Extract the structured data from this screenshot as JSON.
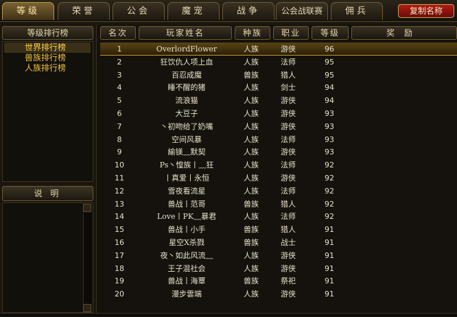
{
  "tabs": [
    {
      "label": "等级",
      "active": true
    },
    {
      "label": "荣誉",
      "active": false
    },
    {
      "label": "公会",
      "active": false
    },
    {
      "label": "魔宠",
      "active": false
    },
    {
      "label": "战争",
      "active": false
    },
    {
      "label": "公会战联赛",
      "active": false
    },
    {
      "label": "佣兵",
      "active": false
    }
  ],
  "copy_name_button": "复制名称",
  "sidebar": {
    "title": "等级排行榜",
    "items": [
      "世界排行榜",
      "兽族排行榜",
      "人族排行榜"
    ],
    "selected_index": 0,
    "description_title": "说 明"
  },
  "table": {
    "headers": [
      "名次",
      "玩家姓名",
      "种族",
      "职业",
      "等级",
      "奖励"
    ],
    "selected_index": 0,
    "rows": [
      {
        "rank": "1",
        "name": "OverlordFlower",
        "race": "人族",
        "job": "游侠",
        "level": "96"
      },
      {
        "rank": "2",
        "name": "狂饮仇人项上血",
        "race": "人族",
        "job": "法师",
        "level": "95"
      },
      {
        "rank": "3",
        "name": "百忍成魔",
        "race": "兽族",
        "job": "猎人",
        "level": "95"
      },
      {
        "rank": "4",
        "name": "睡不醒的猪",
        "race": "人族",
        "job": "剑士",
        "level": "94"
      },
      {
        "rank": "5",
        "name": "流浪猫",
        "race": "人族",
        "job": "游侠",
        "level": "94"
      },
      {
        "rank": "6",
        "name": "大豆子",
        "race": "人族",
        "job": "游侠",
        "level": "93"
      },
      {
        "rank": "7",
        "name": "丶初吻给了奶嘴",
        "race": "人族",
        "job": "游侠",
        "level": "93"
      },
      {
        "rank": "8",
        "name": "空间风暴",
        "race": "人族",
        "job": "法师",
        "level": "93"
      },
      {
        "rank": "9",
        "name": "緰镁﹏默契",
        "race": "人族",
        "job": "游侠",
        "level": "93"
      },
      {
        "rank": "10",
        "name": "Ps丶惶族丨﹏狂",
        "race": "人族",
        "job": "法师",
        "level": "92"
      },
      {
        "rank": "11",
        "name": "丨真爱丨永恒",
        "race": "人族",
        "job": "游侠",
        "level": "92"
      },
      {
        "rank": "12",
        "name": "雪夜看流星",
        "race": "人族",
        "job": "法师",
        "level": "92"
      },
      {
        "rank": "13",
        "name": "兽战丨范哥",
        "race": "兽族",
        "job": "猎人",
        "level": "92"
      },
      {
        "rank": "14",
        "name": "Love丨PK﹏暴君",
        "race": "人族",
        "job": "法师",
        "level": "92"
      },
      {
        "rank": "15",
        "name": "兽战丨小手",
        "race": "兽族",
        "job": "猎人",
        "level": "91"
      },
      {
        "rank": "16",
        "name": "星空X杀戮",
        "race": "兽族",
        "job": "战士",
        "level": "91"
      },
      {
        "rank": "17",
        "name": "夜丶如此风流﹏",
        "race": "人族",
        "job": "游侠",
        "level": "91"
      },
      {
        "rank": "18",
        "name": "王子混社会",
        "race": "人族",
        "job": "游侠",
        "level": "91"
      },
      {
        "rank": "19",
        "name": "兽战丨海覃",
        "race": "兽族",
        "job": "祭祀",
        "level": "91"
      },
      {
        "rank": "20",
        "name": "漫步雲端",
        "race": "人族",
        "job": "游侠",
        "level": "91"
      }
    ]
  }
}
